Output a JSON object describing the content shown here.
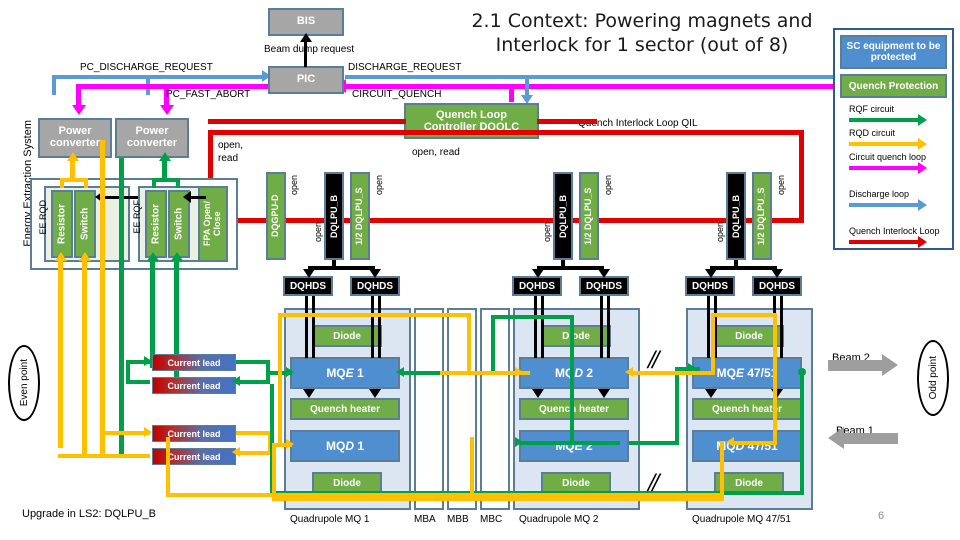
{
  "title": {
    "line1": "2.1 Context: Powering magnets and",
    "line2": "Interlock for 1 sector (out of 8)"
  },
  "page_number": "6",
  "top": {
    "bis": "BIS",
    "pic": "PIC",
    "beam_dump_request": "Beam dump request",
    "pc_discharge_request": "PC_DISCHARGE_REQUEST",
    "pc_fast_abort": "PC_FAST_ABORT",
    "discharge_request": "DISCHARGE_REQUEST",
    "circuit_quench": "CIRCUIT_QUENCH"
  },
  "dqqlc": {
    "line1": "Quench Loop",
    "line2": "Controller DQQLC",
    "open_read": "open, read",
    "open_read_left": "open,",
    "open_read_left2": "read",
    "qil_label": "Quench Interlock Loop QIL"
  },
  "ees": {
    "system_label": "Energy Extraction System",
    "ee_rqd": "EE RQD",
    "ee_rqf": "EE RQF",
    "resistor": "Resistor",
    "switch": "Switch",
    "fpa": "FPA Open/ Close",
    "power_converter_1": "Power converter",
    "power_converter_2": "Power converter"
  },
  "protection_units": [
    {
      "dqgpu": "DQGPU-D",
      "dqgpu_open": "open",
      "dqlpu_b": "DQLPU_B",
      "dqlpu_b_open": "open",
      "dqlpu_s": "1/2 DQLPU_S",
      "dqlpu_s_open": "open",
      "dqhds_left": "DQHDS",
      "dqhds_right": "DQHDS"
    },
    {
      "dqlpu_b": "DQLPU_B",
      "dqlpu_b_open": "open",
      "dqlpu_s": "1/2 DQLPU_S",
      "dqlpu_s_open": "open",
      "dqhds_left": "DQHDS",
      "dqhds_right": "DQHDS"
    },
    {
      "dqlpu_b": "DQLPU_B",
      "dqlpu_b_open": "open",
      "dqlpu_s": "1/2 DQLPU_S",
      "dqlpu_s_open": "open",
      "dqhds_left": "DQHDS",
      "dqhds_right": "DQHDS"
    }
  ],
  "magnet_groups": [
    {
      "caption": "Quadrupole MQ 1",
      "diode_top": "Diode",
      "magnet_top": "MQE 1",
      "magnet_top_pre": "MQ",
      "magnet_top_it": "E",
      "magnet_top_post": " 1",
      "quench_heater": "Quench heater",
      "magnet_bottom_pre": "MQ",
      "magnet_bottom_it": "D",
      "magnet_bottom_post": " 1",
      "diode_bottom": "Diode"
    },
    {
      "caption": "Quadrupole MQ 2",
      "diode_top": "Diode",
      "magnet_top_pre": "MQ",
      "magnet_top_it": "D",
      "magnet_top_post": " 2",
      "quench_heater": "Quench heater",
      "magnet_bottom_pre": "MQ",
      "magnet_bottom_it": "E",
      "magnet_bottom_post": " 2",
      "diode_bottom": "Diode"
    },
    {
      "caption": "Quadrupole MQ 47/51",
      "diode_top": "Diode",
      "magnet_top_pre": "MQ",
      "magnet_top_it": "E",
      "magnet_top_post": " 47/51",
      "quench_heater": "Quench heater",
      "magnet_bottom_pre": "MQ",
      "magnet_bottom_it": "D",
      "magnet_bottom_post": " 47/51",
      "diode_bottom": "Diode"
    }
  ],
  "dipoles": [
    "MBA",
    "MBB",
    "MBC"
  ],
  "current_leads": [
    "Current lead",
    "Current lead",
    "Current lead",
    "Current lead"
  ],
  "beams": {
    "beam2": "Beam 2",
    "beam1": "Beam 1"
  },
  "points": {
    "even": "Even point",
    "odd": "Odd point"
  },
  "footer_note": "Upgrade in LS2: DQLPU_B",
  "legend": {
    "header": "SC equipment to be protected",
    "subheader": "Quench Protection",
    "items": [
      {
        "label": "RQF circuit",
        "color": "#00a04b"
      },
      {
        "label": "RQD circuit",
        "color": "#ffc000"
      },
      {
        "label": "Circuit quench loop",
        "color": "#ff00ff"
      },
      {
        "label": "Discharge loop",
        "color": "#5b9bd5"
      },
      {
        "label": "Quench Interlock Loop",
        "color": "#e00000"
      }
    ]
  },
  "colors": {
    "red": "#e00000",
    "green": "#00a04b",
    "yellow": "#ffc000",
    "magenta": "#ff00ff",
    "light_blue": "#5b9bd5",
    "grey_box": "#a6a6a6",
    "green_box": "#70ad47",
    "blue_box": "#4f8fd0",
    "panel_border": "#5b7d95"
  }
}
